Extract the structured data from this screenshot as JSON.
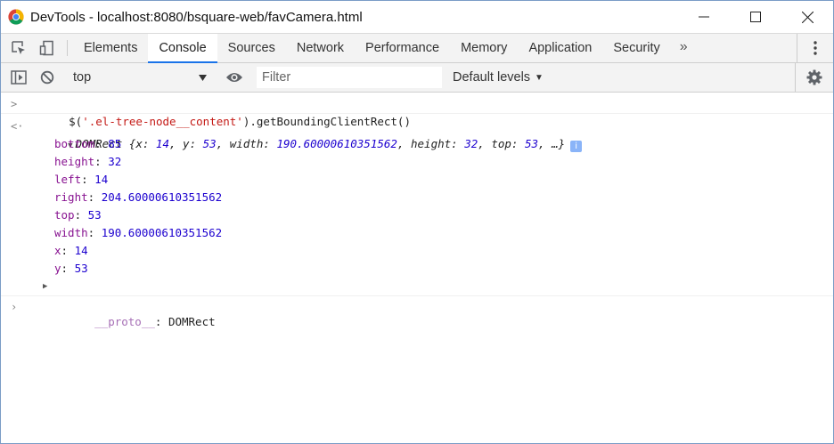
{
  "window": {
    "title": "DevTools - localhost:8080/bsquare-web/favCamera.html"
  },
  "tabs": [
    {
      "label": "Elements",
      "active": false
    },
    {
      "label": "Console",
      "active": true
    },
    {
      "label": "Sources",
      "active": false
    },
    {
      "label": "Network",
      "active": false
    },
    {
      "label": "Performance",
      "active": false
    },
    {
      "label": "Memory",
      "active": false
    },
    {
      "label": "Application",
      "active": false
    },
    {
      "label": "Security",
      "active": false
    }
  ],
  "more_tabs_label": "»",
  "console_toolbar": {
    "context": "top",
    "filter_placeholder": "Filter",
    "levels": "Default levels"
  },
  "console": {
    "input": {
      "fn": "$(",
      "arg": "'.el-tree-node__content'",
      "rest": ").getBoundingClientRect()"
    },
    "result": {
      "type": "DOMRect",
      "preview": [
        {
          "k": "x",
          "v": "14"
        },
        {
          "k": "y",
          "v": "53"
        },
        {
          "k": "width",
          "v": "190.60000610351562"
        },
        {
          "k": "height",
          "v": "32"
        },
        {
          "k": "top",
          "v": "53"
        }
      ],
      "ellipsis": "…}",
      "properties": [
        {
          "k": "bottom",
          "v": "85"
        },
        {
          "k": "height",
          "v": "32"
        },
        {
          "k": "left",
          "v": "14"
        },
        {
          "k": "right",
          "v": "204.60000610351562"
        },
        {
          "k": "top",
          "v": "53"
        },
        {
          "k": "width",
          "v": "190.60000610351562"
        },
        {
          "k": "x",
          "v": "14"
        },
        {
          "k": "y",
          "v": "53"
        }
      ],
      "proto": {
        "k": "__proto__",
        "v": "DOMRect"
      }
    }
  },
  "colors": {
    "accent": "#1a73e8",
    "string": "#c41a16",
    "key": "#881391",
    "number": "#1c00cf"
  }
}
